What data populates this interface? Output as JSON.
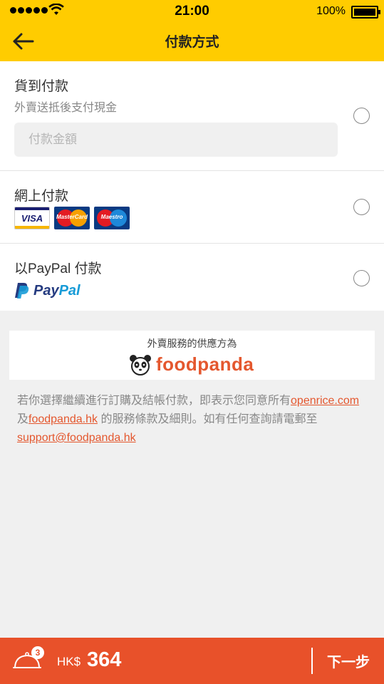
{
  "status_bar": {
    "time": "21:00",
    "battery": "100%"
  },
  "header": {
    "title": "付款方式"
  },
  "payment_options": {
    "cash": {
      "title": "貨到付款",
      "subtitle": "外賣送抵後支付現金",
      "amount_placeholder": "付款金額"
    },
    "online": {
      "title": "網上付款",
      "cards": [
        "VISA",
        "MasterCard",
        "Maestro"
      ]
    },
    "paypal": {
      "title": "以PayPal 付款",
      "logo_pay": "Pay",
      "logo_pal": "Pal"
    }
  },
  "provider": {
    "label": "外賣服務的供應方為",
    "brand": "foodpanda"
  },
  "terms": {
    "text_1": "若你選擇繼續進行訂購及結帳付款，即表示您同意所有",
    "link_1": "openrice.com",
    "text_2": "及",
    "link_2": "foodpanda.hk",
    "text_3": " 的服務條款及細則。如有任何查詢請電郵至",
    "link_3": "support@foodpanda.hk"
  },
  "bottom_bar": {
    "cart_count": "3",
    "currency": "HK$",
    "total": "364",
    "next_label": "下一步"
  },
  "colors": {
    "header_bg": "#ffcc00",
    "accent": "#e8512a",
    "link": "#e4572e"
  }
}
